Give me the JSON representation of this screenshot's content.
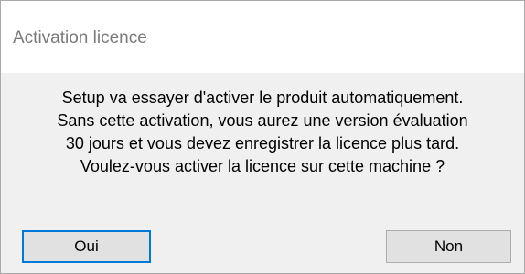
{
  "window": {
    "title": "Activation licence"
  },
  "message": {
    "lines": [
      "Setup va essayer d'activer le produit automatiquement.",
      "Sans cette activation, vous aurez une version évaluation",
      "30 jours et vous devez enregistrer la licence plus tard.",
      "Voulez-vous activer la licence sur cette machine ?"
    ]
  },
  "buttons": {
    "yes_label": "Oui",
    "no_label": "Non"
  },
  "colors": {
    "focus_border": "#0078d7",
    "dialog_background": "#f0f0f0",
    "title_text": "#7a7a7a"
  }
}
